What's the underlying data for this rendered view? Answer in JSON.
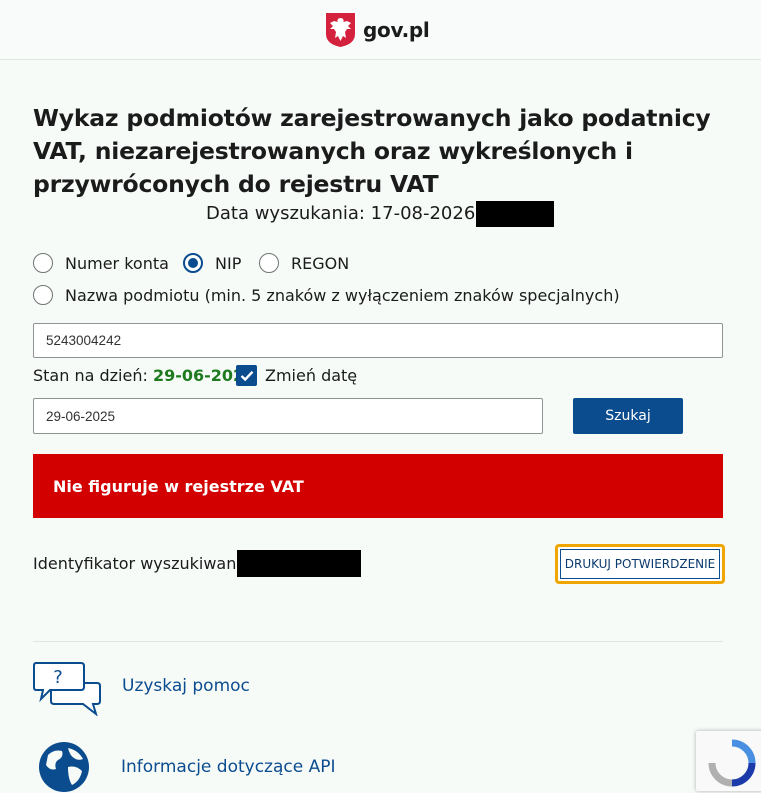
{
  "header": {
    "site_name": "gov.pl"
  },
  "title": "Wykaz podmiotów zarejestrowanych jako podatnicy VAT, niezarejestrowanych oraz wykreślonych  i przywróconych do rejestru VAT",
  "search_date": {
    "label": "Data wyszukania: 17-08-2026"
  },
  "search_type": {
    "options": [
      {
        "label": "Numer konta",
        "selected": false
      },
      {
        "label": "NIP",
        "selected": true
      },
      {
        "label": "REGON",
        "selected": false
      },
      {
        "label": "Nazwa podmiotu (min. 5 znaków z wyłączeniem znaków specjalnych)",
        "selected": false
      }
    ]
  },
  "query_input": {
    "value": "5243004242"
  },
  "stan": {
    "label": "Stan na dzień:",
    "date": "29-06-2025"
  },
  "change_date": {
    "label": "Zmień datę",
    "checked": true
  },
  "date_input": {
    "value": "29-06-2025"
  },
  "search_button": {
    "label": "Szukaj"
  },
  "result": {
    "message": "Nie figuruje w rejestrze VAT",
    "color": "#d30000"
  },
  "identifier": {
    "label": "Identyfikator wyszukiwania:"
  },
  "print_button": {
    "label": "DRUKUJ POTWIERDZENIE"
  },
  "links": {
    "help": {
      "label": "Uzyskaj pomoc",
      "icon": "chat-help-icon"
    },
    "api": {
      "label": "Informacje dotyczące API",
      "icon": "globe-icon"
    }
  },
  "colors": {
    "primary": "#0b4c8f",
    "accent_green": "#1f7a1f",
    "focus": "#f0a500"
  }
}
